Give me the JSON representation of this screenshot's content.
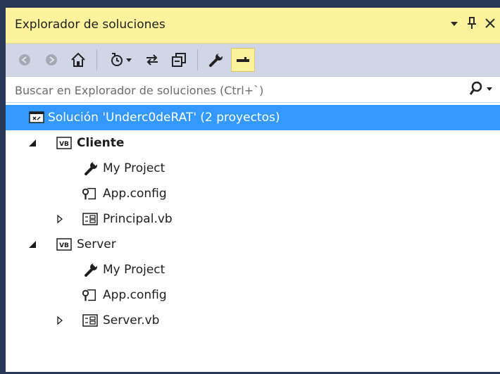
{
  "panel": {
    "title": "Explorador de soluciones",
    "dropdown_glyph": "▾",
    "pin_glyph": "ྤ",
    "close_glyph": "✕"
  },
  "toolbar": {
    "buttons": [
      {
        "name": "back-icon",
        "enabled": false
      },
      {
        "name": "forward-icon",
        "enabled": false
      },
      {
        "name": "home-icon",
        "enabled": true
      },
      {
        "name": "pending-changes-filter-icon",
        "enabled": true
      },
      {
        "name": "sync-icon",
        "enabled": true
      },
      {
        "name": "collapse-all-icon",
        "enabled": true
      },
      {
        "name": "properties-icon",
        "enabled": true
      },
      {
        "name": "preview-selected-icon",
        "enabled": true,
        "active": true
      }
    ]
  },
  "search": {
    "placeholder": "Buscar en Explorador de soluciones (Ctrl+`)"
  },
  "tree": {
    "solution": "Solución 'Underc0deRAT'  (2 proyectos)",
    "projects": [
      {
        "name": "Cliente",
        "bold": true,
        "expanded": true,
        "items": [
          {
            "label": "My Project",
            "icon": "wrench-icon"
          },
          {
            "label": "App.config",
            "icon": "config-file-icon"
          },
          {
            "label": "Principal.vb",
            "icon": "form-icon",
            "expandable": true
          }
        ]
      },
      {
        "name": "Server",
        "bold": false,
        "expanded": true,
        "items": [
          {
            "label": "My Project",
            "icon": "wrench-icon"
          },
          {
            "label": "App.config",
            "icon": "config-file-icon"
          },
          {
            "label": "Server.vb",
            "icon": "form-icon",
            "expandable": true
          }
        ]
      }
    ]
  },
  "colors": {
    "title_bg": "#fff29d",
    "toolbar_bg": "#cfd6e5",
    "selection": "#3399ff",
    "frame": "#293955"
  }
}
